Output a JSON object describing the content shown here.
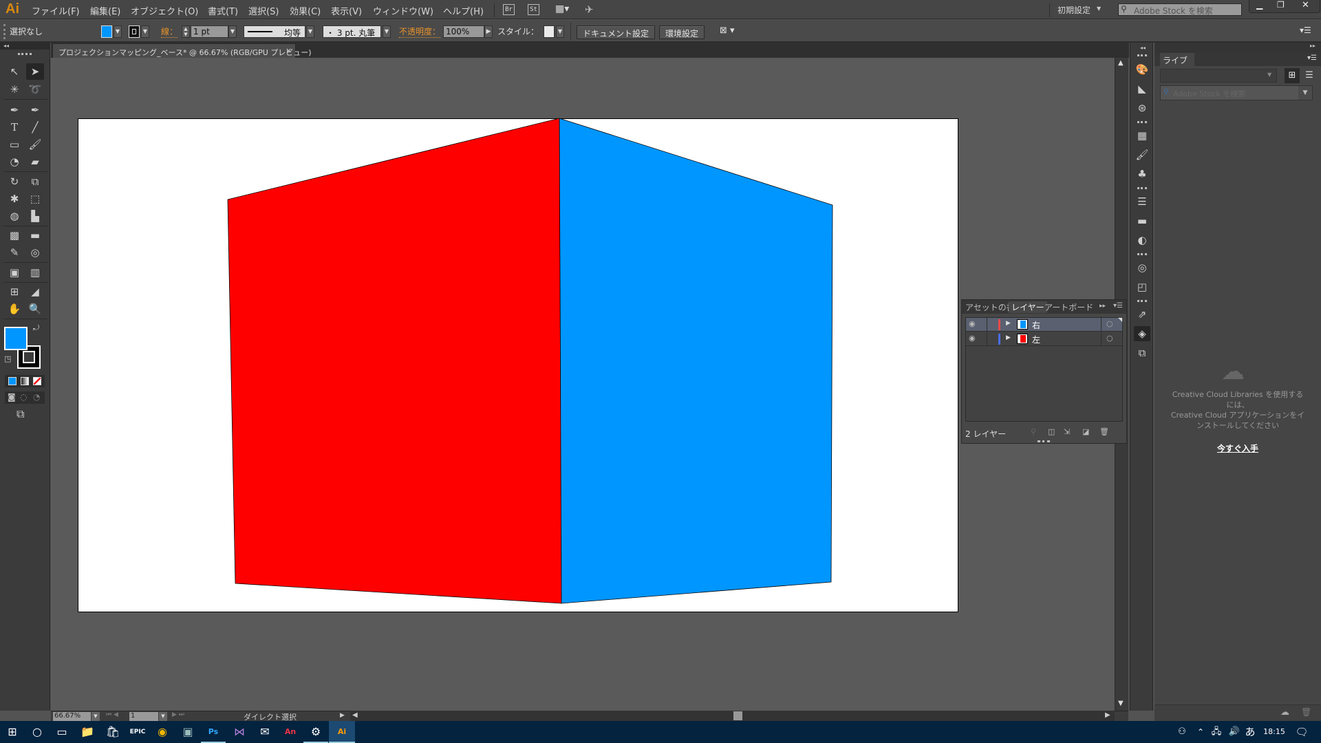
{
  "app": {
    "logo": "Ai",
    "menu": [
      "ファイル(F)",
      "編集(E)",
      "オブジェクト(O)",
      "書式(T)",
      "選択(S)",
      "効果(C)",
      "表示(V)",
      "ウィンドウ(W)",
      "ヘルプ(H)"
    ],
    "bridge_label": "Br",
    "stock_label": "St",
    "workspace": "初期設定",
    "stock_search_placeholder": "Adobe Stock を検索"
  },
  "control": {
    "selection": "選択なし",
    "fill_color": "#0096ff",
    "stroke_label": "線：",
    "stroke_weight": "1 pt",
    "stroke_profile": "均等",
    "brush": "・ 3 pt. 丸筆",
    "opacity_label": "不透明度：",
    "opacity": "100%",
    "style_label": "スタイル：",
    "doc_settings": "ドキュメント設定",
    "preferences": "環境設定"
  },
  "document": {
    "tab_title": "プロジェクションマッピング_ベース* @ 66.67% (RGB/GPU プレビュー)",
    "close": "×",
    "faces": [
      {
        "name": "左",
        "color": "#ff0000"
      },
      {
        "name": "右",
        "color": "#0096ff"
      }
    ]
  },
  "status": {
    "zoom": "66.67%",
    "artboard": "1",
    "tool": "ダイレクト選択"
  },
  "layers_panel": {
    "tabs": [
      "アセットの書",
      "レイヤー",
      "アートボード"
    ],
    "active_tab": "レイヤー",
    "layers": [
      {
        "name": "右",
        "color": "#0096ff",
        "label_color": "#e84a4a",
        "selected": true
      },
      {
        "name": "左",
        "color": "#ff0000",
        "label_color": "#4a6ee8",
        "selected": false
      }
    ],
    "count": "2 レイヤー"
  },
  "library": {
    "title": "ライブラリ",
    "search_placeholder": "Adobe Stock を検索",
    "message_line1": "Creative Cloud Libraries を使用するには、",
    "message_line2": "Creative Cloud アプリケーションをインストールしてください",
    "get_now": "今すぐ入手"
  },
  "taskbar": {
    "apps": [
      "windows",
      "cortana",
      "task-view",
      "explorer",
      "store",
      "epic",
      "chrome",
      "app",
      "photoshop",
      "visual-studio",
      "mail",
      "animate",
      "settings",
      "illustrator"
    ],
    "ime": "あ",
    "time": "18:15"
  }
}
